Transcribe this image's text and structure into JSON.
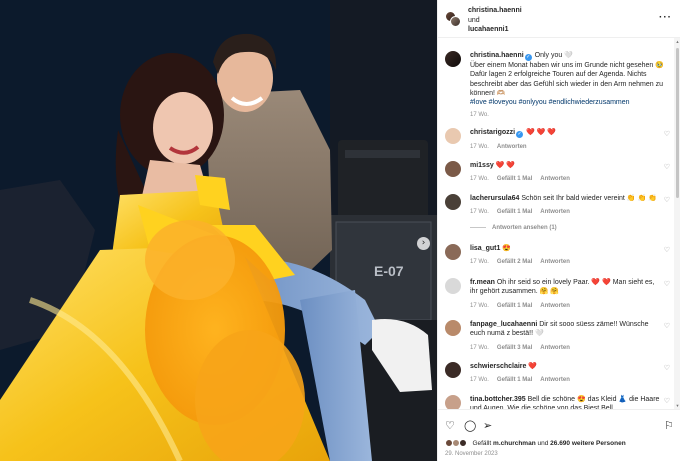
{
  "photo": {
    "case_label": "E-07",
    "next_icon": "chevron-right-icon"
  },
  "header": {
    "user1": "christina.haenni",
    "joiner": "und",
    "user2": "lucahaenni1",
    "more_icon": "more-horizontal-icon"
  },
  "caption": {
    "username": "christina.haenni",
    "first_line": "Only you 🤍",
    "text": "Über einem Monat haben wir uns im Grunde nicht gesehen 🥹 Dafür lagen 2 erfolgreiche Touren auf der Agenda. Nichts beschreibt aber das Gefühl sich wieder in den Arm nehmen zu können! 🫶🏼",
    "hashtags": "#love #loveyou #onlyyou #endlichwiederzusammen",
    "time": "17 Wo."
  },
  "comments": [
    {
      "username": "christarigozzi",
      "verified": true,
      "text": "❤️ ❤️ ❤️",
      "time": "17 Wo.",
      "likes": "",
      "reply": "Antworten",
      "avatar_color": "#e9c9b0"
    },
    {
      "username": "mi1ssy",
      "verified": false,
      "text": "❤️ ❤️",
      "time": "17 Wo.",
      "likes": "Gefällt 1 Mal",
      "reply": "Antworten",
      "avatar_color": "#7b5a48"
    },
    {
      "username": "lacherursula64",
      "verified": false,
      "text": "Schön seit Ihr bald wieder vereint 👏 👏 👏",
      "time": "17 Wo.",
      "likes": "Gefällt 1 Mal",
      "reply": "Antworten",
      "avatar_color": "#4a4038"
    },
    {
      "username": "lisa_gut1",
      "verified": false,
      "text": "😍",
      "time": "17 Wo.",
      "likes": "Gefällt 2 Mal",
      "reply": "Antworten",
      "avatar_color": "#8a6a58"
    },
    {
      "username": "fr.mean",
      "verified": false,
      "text": "Oh ihr seid so ein lovely Paar. ❤️ ❤️ Man sieht es, ihr gehört zusammen. 🤗 🤗",
      "time": "17 Wo.",
      "likes": "Gefällt 1 Mal",
      "reply": "Antworten",
      "avatar_color": "#d9d9d9"
    },
    {
      "username": "fanpage_lucahaenni",
      "verified": false,
      "text": "Dir sit sooo süess zäme!! Wünsche euch numä z bestä!! 🤍",
      "time": "17 Wo.",
      "likes": "Gefällt 3 Mal",
      "reply": "Antworten",
      "avatar_color": "#b98a6a"
    },
    {
      "username": "schwierschclaire",
      "verified": false,
      "text": "❤️",
      "time": "17 Wo.",
      "likes": "Gefällt 1 Mal",
      "reply": "Antworten",
      "avatar_color": "#3b2b26"
    },
    {
      "username": "tina.bottcher.395",
      "verified": false,
      "text": "Bell die schöne 😍 das Kleid 👗 die Haare und Augen. Wie die schöne von das Biest Bell",
      "time": "",
      "likes": "",
      "reply": "",
      "avatar_color": "#c7a08a"
    }
  ],
  "view_replies": "Antworten ansehen (1)",
  "actions": {
    "like_icon": "heart-icon",
    "comment_icon": "comment-icon",
    "share_icon": "send-icon",
    "save_icon": "bookmark-icon",
    "liked_by_prefix": "Gefällt",
    "liked_by_user": "m.churchman",
    "liked_by_suffix": "und",
    "liked_by_count": "26.690 weitere Personen",
    "date": "29. November 2023"
  }
}
